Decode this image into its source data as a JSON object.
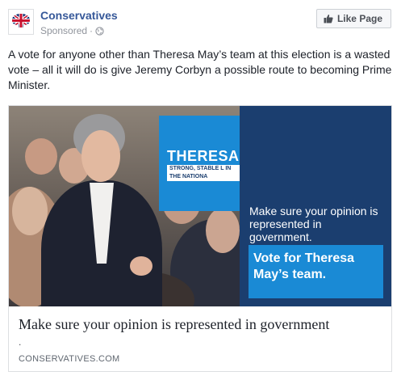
{
  "post": {
    "page_name": "Conservatives",
    "sponsored_label": "Sponsored",
    "separator": "·",
    "privacy_icon": "globe-icon",
    "like_button_label": "Like Page",
    "like_icon": "thumbs-up-icon",
    "avatar_icon": "union-jack-tree-logo",
    "text": "A vote for anyone other than Theresa May’s team at this election is a wasted vote – all it will do is give Jeremy Corbyn a possible route to becoming Prime Minister."
  },
  "ad_creative": {
    "sign_text": "THERESA",
    "sign_strip_text": "STRONG, STABLE L IN THE NATIONA",
    "message": "Make sure your opinion is represented in government.",
    "cta_text": "Vote for Theresa May’s team."
  },
  "link_preview": {
    "title": "Make sure your opinion is represented in government",
    "description": ".",
    "domain": "CONSERVATIVES.COM"
  },
  "colors": {
    "page_name": "#365899",
    "panel_navy": "#1b3e6f",
    "accent_blue": "#1a8ad5"
  }
}
